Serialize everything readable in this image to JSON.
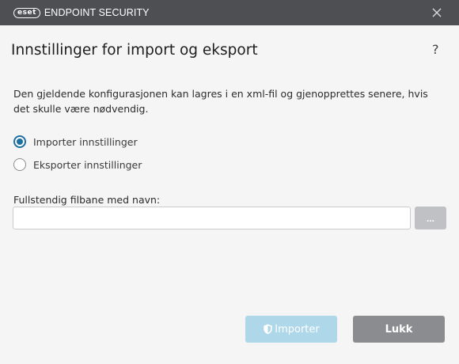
{
  "window": {
    "logo_text": "eset",
    "product_name": "ENDPOINT SECURITY"
  },
  "dialog": {
    "title": "Innstillinger for import og eksport",
    "help_label": "?",
    "description": "Den gjeldende konfigurasjonen kan lagres i en xml-fil og gjenopprettes senere, hvis det skulle være nødvendig.",
    "options": [
      {
        "label": "Importer innstillinger",
        "selected": true
      },
      {
        "label": "Eksporter innstillinger",
        "selected": false
      }
    ],
    "path_label": "Fullstendig filbane med navn:",
    "path_value": "",
    "browse_label": "...",
    "import_label": "Importer",
    "close_label": "Lukk"
  },
  "colors": {
    "titlebar": "#4d4f53",
    "accent": "#1c6fa0",
    "import_disabled": "#aed7ea",
    "close_button": "#8a8c8f"
  }
}
